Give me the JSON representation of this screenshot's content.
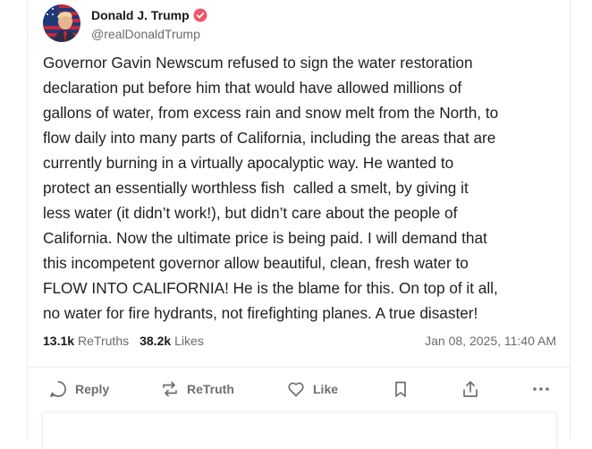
{
  "post": {
    "display_name": "Donald J. Trump",
    "handle": "@realDonaldTrump",
    "verified_color": "#f0556a",
    "text": "Governor Gavin Newscum refused to sign the water restoration\ndeclaration put before him that would have allowed millions of\ngallons of water, from excess rain and snow melt from the North, to\nflow daily into many parts of California, including the areas that are\ncurrently burning in a virtually apocalyptic way. He wanted to\nprotect an essentially worthless fish  called a smelt, by giving it\nless water (it didn’t work!), but didn’t care about the people of\nCalifornia. Now the ultimate price is being paid. I will demand that\nthis incompetent governor allow beautiful, clean, fresh water to\nFLOW INTO CALIFORNIA! He is the blame for this. On top of it all,\nno water for fire hydrants, not firefighting planes. A true disaster!",
    "retruths_count": "13.1k",
    "retruths_label": "ReTruths",
    "likes_count": "38.2k",
    "likes_label": "Likes",
    "timestamp": "Jan 08, 2025, 11:40 AM"
  },
  "actions": {
    "reply_label": "Reply",
    "retruth_label": "ReTruth",
    "like_label": "Like",
    "icons": [
      "reply-icon",
      "retruth-icon",
      "like-icon",
      "bookmark-icon",
      "share-icon",
      "more-icon"
    ]
  }
}
